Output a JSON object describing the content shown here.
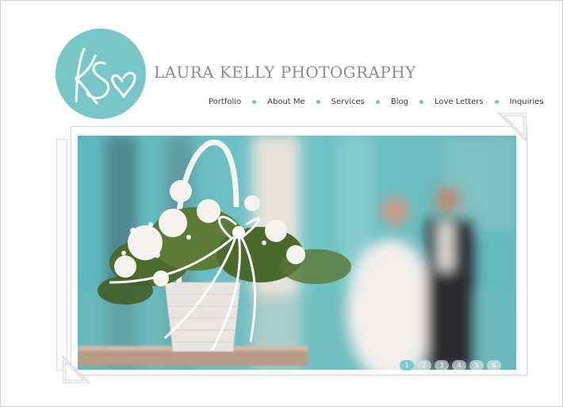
{
  "brand": {
    "title": "LAURA KELLY PHOTOGRAPHY",
    "logo_icon": "ks-monogram-heart-icon",
    "accent_color": "#79c6c8"
  },
  "nav": {
    "items": [
      {
        "label": "Portfolio"
      },
      {
        "label": "About Me"
      },
      {
        "label": "Services"
      },
      {
        "label": "Blog"
      },
      {
        "label": "Love Letters"
      },
      {
        "label": "Inquiries"
      }
    ],
    "separator_icon": "teal-dot-icon"
  },
  "slider": {
    "image_subject": "wedding-flower-basket-photo",
    "active_index": 1,
    "pages": [
      "1",
      "2",
      "3",
      "4",
      "5",
      "6"
    ]
  }
}
